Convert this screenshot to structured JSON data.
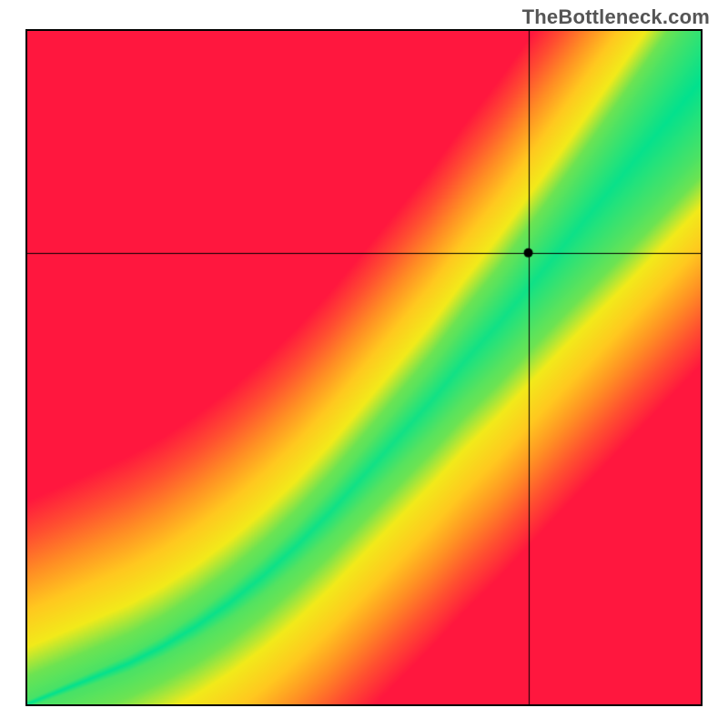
{
  "attribution": "TheBottleneck.com",
  "chart_data": {
    "type": "heatmap",
    "title": "",
    "xlabel": "",
    "ylabel": "",
    "xlim": [
      0,
      1
    ],
    "ylim": [
      0,
      1
    ],
    "grid": false,
    "legend": null,
    "curve": {
      "description": "monotone sweet-spot curve from bottom-left toward top-right used to color the heatmap (green on-curve, red far away)",
      "points": [
        {
          "x": 0.0,
          "y": 0.0
        },
        {
          "x": 0.05,
          "y": 0.02
        },
        {
          "x": 0.1,
          "y": 0.04
        },
        {
          "x": 0.15,
          "y": 0.06
        },
        {
          "x": 0.2,
          "y": 0.085
        },
        {
          "x": 0.25,
          "y": 0.115
        },
        {
          "x": 0.3,
          "y": 0.15
        },
        {
          "x": 0.35,
          "y": 0.19
        },
        {
          "x": 0.4,
          "y": 0.235
        },
        {
          "x": 0.45,
          "y": 0.285
        },
        {
          "x": 0.5,
          "y": 0.34
        },
        {
          "x": 0.55,
          "y": 0.395
        },
        {
          "x": 0.6,
          "y": 0.45
        },
        {
          "x": 0.65,
          "y": 0.51
        },
        {
          "x": 0.7,
          "y": 0.565
        },
        {
          "x": 0.75,
          "y": 0.625
        },
        {
          "x": 0.8,
          "y": 0.685
        },
        {
          "x": 0.85,
          "y": 0.745
        },
        {
          "x": 0.9,
          "y": 0.805
        },
        {
          "x": 0.95,
          "y": 0.865
        },
        {
          "x": 1.0,
          "y": 0.925
        }
      ]
    },
    "band_half_width": {
      "note": "green band half-thickness as a function of x (normalized y units)",
      "points": [
        {
          "x": 0.0,
          "w": 0.005
        },
        {
          "x": 0.2,
          "w": 0.015
        },
        {
          "x": 0.4,
          "w": 0.03
        },
        {
          "x": 0.6,
          "w": 0.05
        },
        {
          "x": 0.8,
          "w": 0.075
        },
        {
          "x": 1.0,
          "w": 0.105
        }
      ]
    },
    "color_stops": {
      "note": "color as a function of distance (dy / gradient_scale); 0=on curve",
      "stops": [
        {
          "t": 0.0,
          "color": "#00e18f"
        },
        {
          "t": 0.28,
          "color": "#6de352"
        },
        {
          "t": 0.4,
          "color": "#f2ea1a"
        },
        {
          "t": 0.55,
          "color": "#ffc81f"
        },
        {
          "t": 0.7,
          "color": "#ff8e24"
        },
        {
          "t": 0.85,
          "color": "#ff4f30"
        },
        {
          "t": 1.0,
          "color": "#ff173e"
        }
      ],
      "gradient_scale": 0.4
    },
    "crosshair": {
      "x": 0.745,
      "y": 0.67
    },
    "marker": {
      "x": 0.745,
      "y": 0.67,
      "radius_px": 5,
      "color": "#000000"
    }
  }
}
